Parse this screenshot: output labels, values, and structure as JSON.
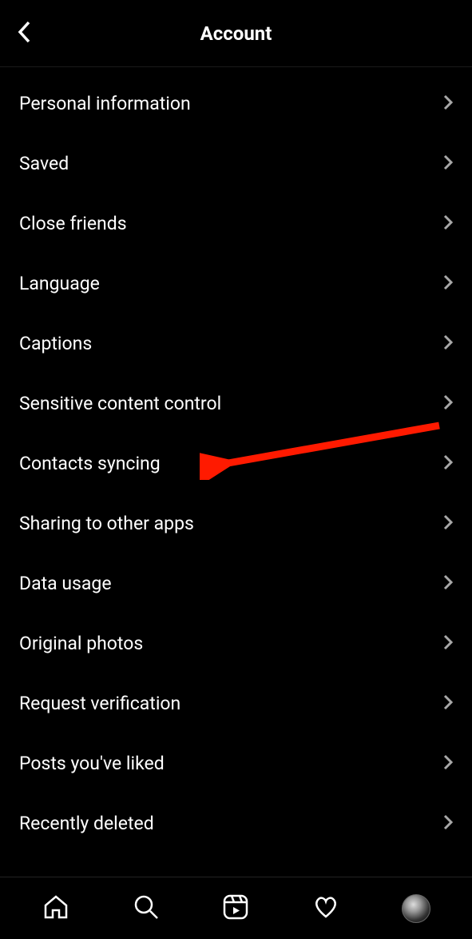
{
  "header": {
    "title": "Account"
  },
  "menu": {
    "items": [
      {
        "label": "Personal information"
      },
      {
        "label": "Saved"
      },
      {
        "label": "Close friends"
      },
      {
        "label": "Language"
      },
      {
        "label": "Captions"
      },
      {
        "label": "Sensitive content control"
      },
      {
        "label": "Contacts syncing"
      },
      {
        "label": "Sharing to other apps"
      },
      {
        "label": "Data usage"
      },
      {
        "label": "Original photos"
      },
      {
        "label": "Request verification"
      },
      {
        "label": "Posts you've liked"
      },
      {
        "label": "Recently deleted"
      }
    ]
  },
  "annotation": {
    "target_index": 6,
    "color": "#ff0000"
  }
}
